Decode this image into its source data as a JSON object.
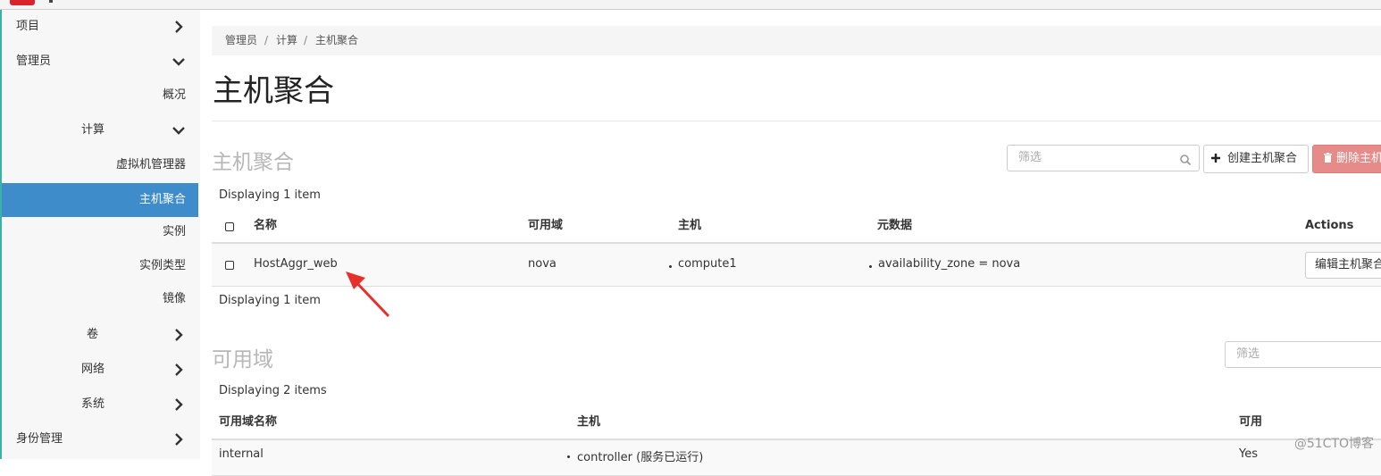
{
  "sidebar": {
    "items": [
      {
        "label": "项目"
      },
      {
        "label": "管理员"
      },
      {
        "label": "概况"
      },
      {
        "label": "计算"
      },
      {
        "label": "虚拟机管理器"
      },
      {
        "label": "主机聚合"
      },
      {
        "label": "实例"
      },
      {
        "label": "实例类型"
      },
      {
        "label": "镜像"
      },
      {
        "label": "卷"
      },
      {
        "label": "网络"
      },
      {
        "label": "系统"
      },
      {
        "label": "身份管理"
      }
    ]
  },
  "breadcrumb": [
    "管理员",
    "计算",
    "主机聚合"
  ],
  "breadcrumb_sep": "/",
  "page_title": "主机聚合",
  "host_aggregates": {
    "title": "主机聚合",
    "filter_placeholder": "筛选",
    "create_button": "创建主机聚合",
    "delete_button": "删除主机",
    "count_text": "Displaying 1 item",
    "columns": [
      "名称",
      "可用域",
      "主机",
      "元数据",
      "Actions"
    ],
    "rows": [
      {
        "name": "HostAggr_web",
        "zone": "nova",
        "host": "compute1",
        "metadata": "availability_zone = nova",
        "action": "编辑主机聚合"
      }
    ],
    "footer_count": "Displaying 1 item"
  },
  "availability_zones": {
    "title": "可用域",
    "filter_placeholder": "筛选",
    "count_text": "Displaying 2 items",
    "columns": [
      "可用域名称",
      "主机",
      "可用"
    ],
    "rows": [
      {
        "name": "internal",
        "host": "controller (服务已运行)",
        "available": "Yes"
      }
    ]
  },
  "watermark": "@51CTO博客",
  "colors": {
    "sidebar_active": "#3f8ccb",
    "danger_button": "#e58c8b",
    "annotation_arrow": "#e8302b",
    "sidebar_accent": "#3bb0a9"
  }
}
